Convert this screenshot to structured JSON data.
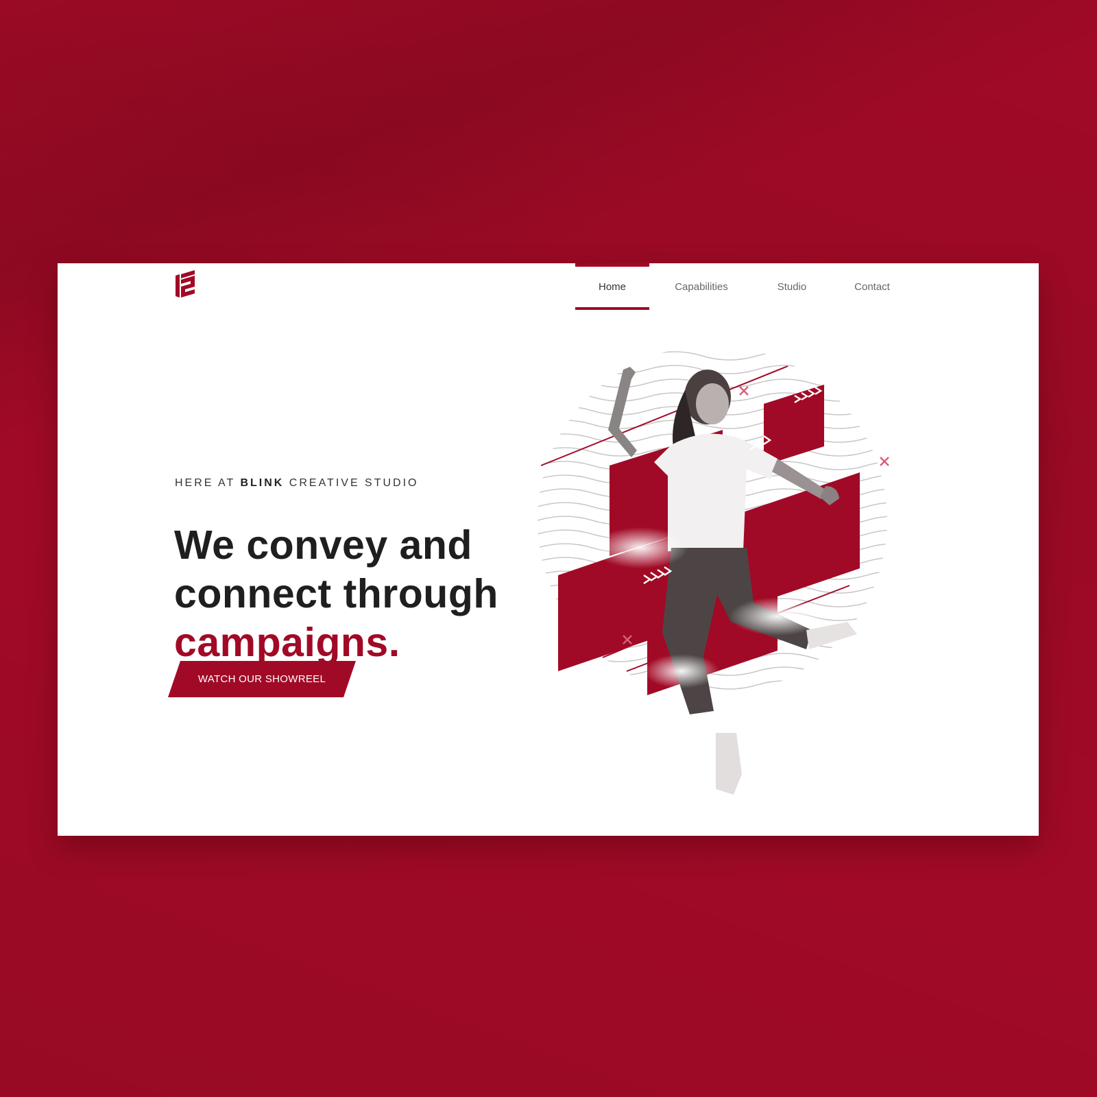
{
  "theme": {
    "accent": "#a10a26",
    "background": "#a10a26",
    "card": "#ffffff"
  },
  "nav": {
    "items": [
      {
        "label": "Home",
        "active": true
      },
      {
        "label": "Capabilities",
        "active": false
      },
      {
        "label": "Studio",
        "active": false
      },
      {
        "label": "Contact",
        "active": false
      }
    ]
  },
  "hero": {
    "eyebrow_prefix": "HERE AT",
    "eyebrow_brand": "BLINK",
    "eyebrow_suffix": "CREATIVE STUDIO",
    "title_line1": "We convey and",
    "title_line2": "connect through",
    "title_accent": "campaigns.",
    "cta_label": "WATCH OUR SHOWREEL"
  },
  "icons": {
    "logo": "logo-mark-icon",
    "decor": [
      "x-mark-icon",
      "chevron-arrows-icon"
    ]
  }
}
